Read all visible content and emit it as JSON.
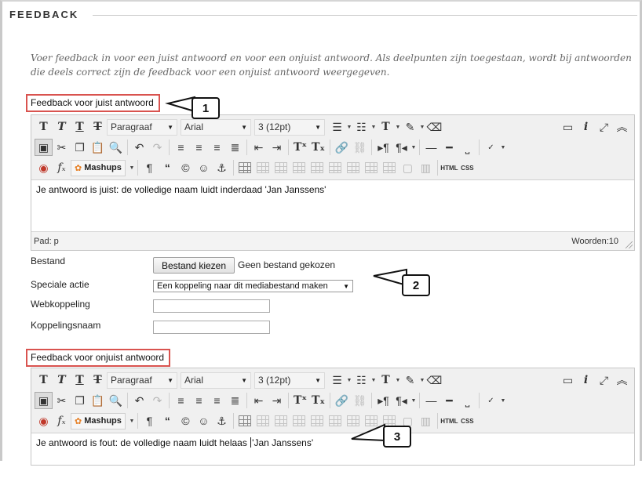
{
  "section": {
    "title": "FEEDBACK"
  },
  "instructions": "Voer feedback in voor een juist antwoord en voor een onjuist antwoord. Als deelpunten zijn toegestaan, wordt bij antwoorden die deels correct zijn de feedback voor een onjuist antwoord weergegeven.",
  "feedback_correct": {
    "label": "Feedback voor juist antwoord",
    "format_value": "Paragraaf",
    "font_value": "Arial",
    "size_value": "3 (12pt)",
    "mashups_label": "Mashups",
    "html_label": "HTML",
    "css_label": "CSS",
    "content": "Je antwoord is juist: de volledige naam luidt inderdaad 'Jan Janssens'",
    "path_label": "Pad: p",
    "word_count": "Woorden:10"
  },
  "attachment": {
    "file_label": "Bestand",
    "file_button": "Bestand kiezen",
    "file_status": "Geen bestand gekozen",
    "action_label": "Speciale actie",
    "action_value": "Een koppeling naar dit mediabestand maken",
    "link_label": "Webkoppeling",
    "linkname_label": "Koppelingsnaam"
  },
  "feedback_incorrect": {
    "label": "Feedback voor onjuist antwoord",
    "format_value": "Paragraaf",
    "font_value": "Arial",
    "size_value": "3 (12pt)",
    "mashups_label": "Mashups",
    "html_label": "HTML",
    "css_label": "CSS",
    "content_before_caret": "Je antwoord is fout: de volledige naam luidt helaas ",
    "content_after_caret": "'Jan Janssens'"
  },
  "callouts": {
    "one": "1",
    "two": "2",
    "three": "3"
  },
  "colors": {
    "highlight_border": "#d9534f",
    "toolbar_bg": "#f0f0f0"
  }
}
